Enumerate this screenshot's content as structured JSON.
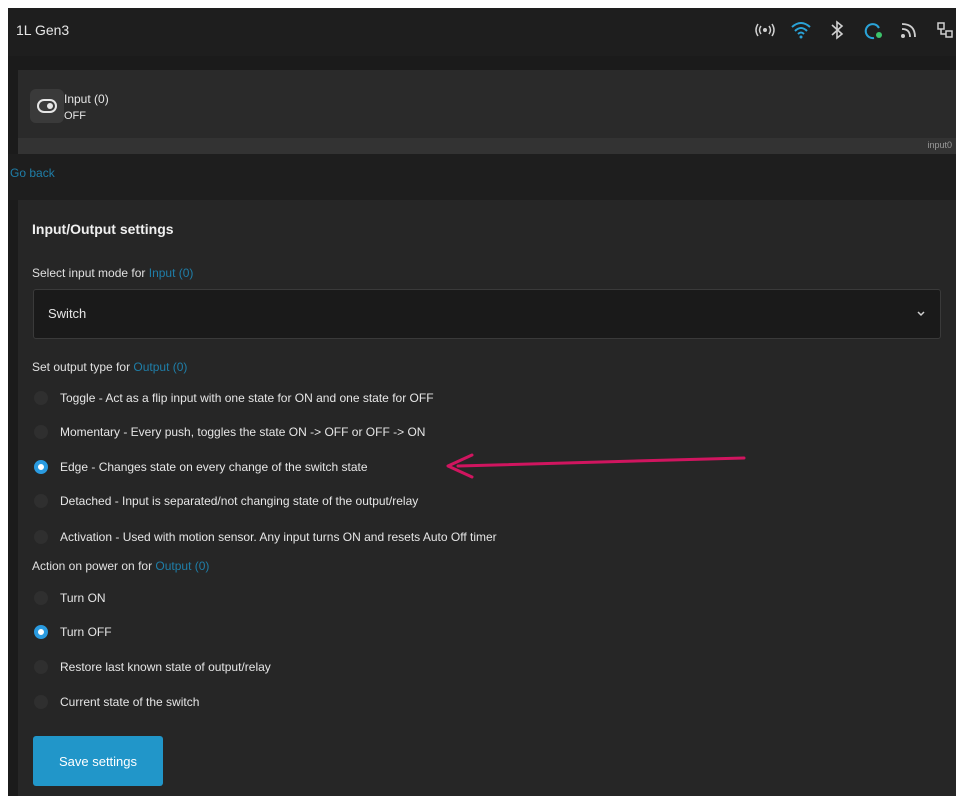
{
  "topbar": {
    "title": "1L Gen3",
    "icons": [
      "radio-waves-icon",
      "wifi-icon",
      "bluetooth-icon",
      "cloud-sync-icon",
      "rss-icon",
      "network-icon"
    ]
  },
  "device": {
    "name": "Input (0)",
    "state": "OFF",
    "id": "input0"
  },
  "nav": {
    "go_back": "Go back"
  },
  "settings": {
    "title": "Input/Output settings",
    "input_mode": {
      "label_prefix": "Select input mode for ",
      "link": "Input (0)",
      "selected": "Switch"
    },
    "output_type": {
      "label_prefix": "Set output type for ",
      "link": "Output (0)",
      "options": [
        {
          "label": "Toggle - Act as a flip input with one state for ON and one state for OFF",
          "checked": false
        },
        {
          "label": "Momentary - Every push, toggles the state ON -> OFF or OFF -> ON",
          "checked": false
        },
        {
          "label": "Edge - Changes state on every change of the switch state",
          "checked": true
        },
        {
          "label": "Detached - Input is separated/not changing state of the output/relay",
          "checked": false
        },
        {
          "label": "Activation - Used with motion sensor. Any input turns ON and resets Auto Off timer",
          "checked": false
        }
      ]
    },
    "power_on": {
      "label_prefix": "Action on power on for ",
      "link": "Output (0)",
      "options": [
        {
          "label": "Turn ON",
          "checked": false
        },
        {
          "label": "Turn OFF",
          "checked": true
        },
        {
          "label": "Restore last known state of output/relay",
          "checked": false
        },
        {
          "label": "Current state of the switch",
          "checked": false
        }
      ]
    },
    "save_label": "Save settings"
  },
  "colors": {
    "accent": "#2196c9",
    "link": "#1f7ea8",
    "annotation_arrow": "#d0155f"
  }
}
